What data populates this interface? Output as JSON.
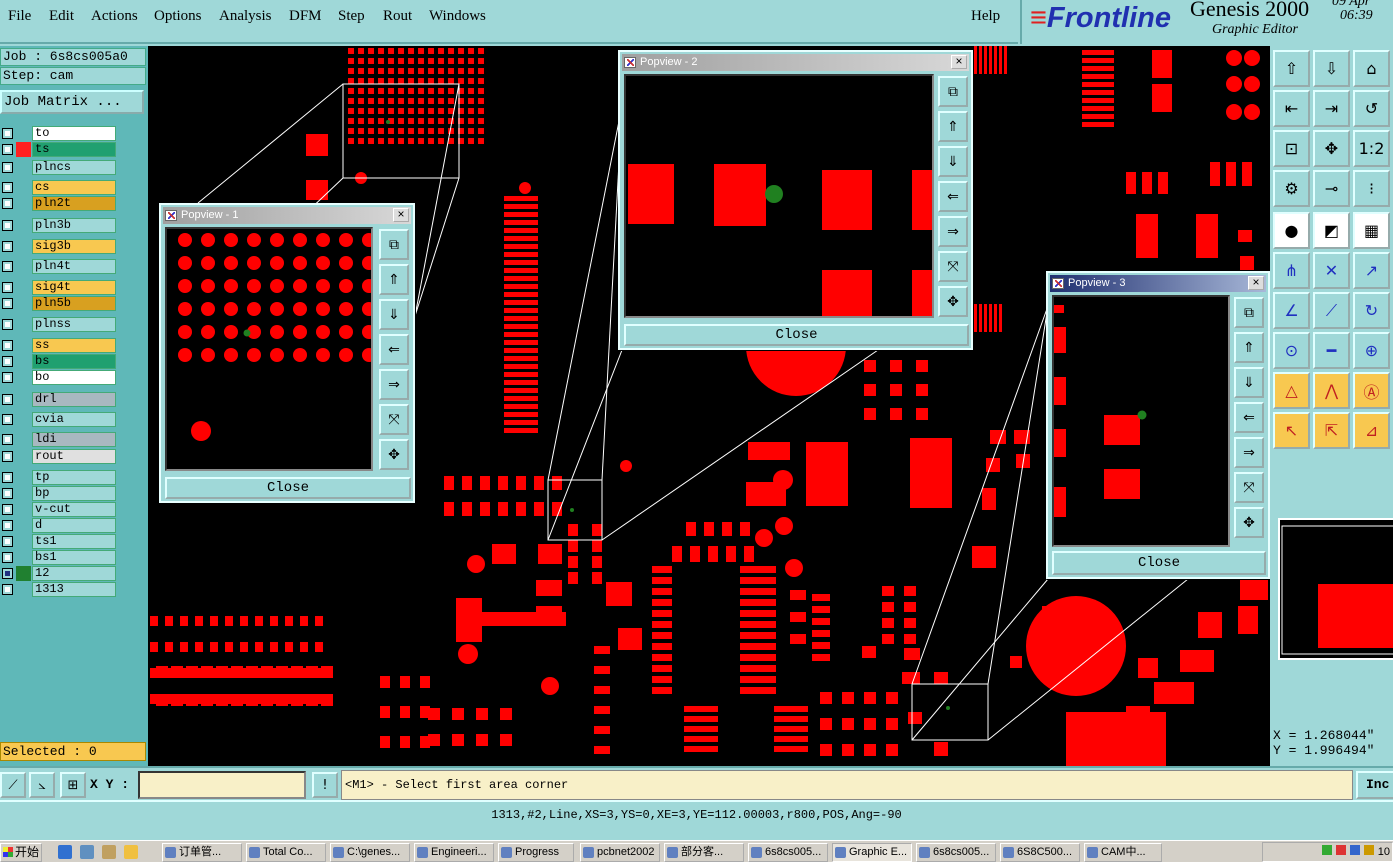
{
  "menu": [
    "File",
    "Edit",
    "Actions",
    "Options",
    "Analysis",
    "DFM",
    "Step",
    "Rout",
    "Windows"
  ],
  "help_label": "Help",
  "brand": {
    "logo": "Frontline",
    "product": "Genesis 2000",
    "subtitle": "Graphic Editor",
    "date": "09 Apr",
    "time": "06:39"
  },
  "job": {
    "job_line": "Job : 6s8cs005a0",
    "step_line": "Step: cam",
    "matrix_button": "Job Matrix ..."
  },
  "layers": [
    {
      "name": "to",
      "bg": "#ffffff",
      "mark": ""
    },
    {
      "name": "ts",
      "bg": "#20a070",
      "mark": "#ff2020"
    },
    {
      "name": "plncs",
      "bg": "#9fd8d8",
      "mark": ""
    },
    {
      "name": "cs",
      "bg": "#f8c850",
      "mark": ""
    },
    {
      "name": "pln2t",
      "bg": "#d8a020",
      "mark": ""
    },
    {
      "name": "pln3b",
      "bg": "#9fd8d8",
      "mark": ""
    },
    {
      "name": "sig3b",
      "bg": "#f8c850",
      "mark": ""
    },
    {
      "name": "pln4t",
      "bg": "#9fd8d8",
      "mark": ""
    },
    {
      "name": "sig4t",
      "bg": "#f8c850",
      "mark": ""
    },
    {
      "name": "pln5b",
      "bg": "#d8a020",
      "mark": ""
    },
    {
      "name": "plnss",
      "bg": "#9fd8d8",
      "mark": ""
    },
    {
      "name": "ss",
      "bg": "#f8c850",
      "mark": ""
    },
    {
      "name": "bs",
      "bg": "#20a070",
      "mark": ""
    },
    {
      "name": "bo",
      "bg": "#ffffff",
      "mark": ""
    },
    {
      "name": "drl",
      "bg": "#a8b8c0",
      "mark": ""
    },
    {
      "name": "cvia",
      "bg": "#9fd8d8",
      "mark": ""
    },
    {
      "name": "ldi",
      "bg": "#a8b8c0",
      "mark": ""
    },
    {
      "name": "rout",
      "bg": "#e0e0e0",
      "mark": ""
    },
    {
      "name": "tp",
      "bg": "#9fd8d8",
      "mark": ""
    },
    {
      "name": "bp",
      "bg": "#9fd8d8",
      "mark": ""
    },
    {
      "name": "v-cut",
      "bg": "#9fd8d8",
      "mark": ""
    },
    {
      "name": "d",
      "bg": "#9fd8d8",
      "mark": ""
    },
    {
      "name": "ts1",
      "bg": "#9fd8d8",
      "mark": ""
    },
    {
      "name": "bs1",
      "bg": "#9fd8d8",
      "mark": ""
    },
    {
      "name": "12",
      "bg": "#9fd8d8",
      "mark": "#208030"
    },
    {
      "name": "1313",
      "bg": "#9fd8d8",
      "mark": ""
    }
  ],
  "selected": "Selected : 0",
  "popups": [
    {
      "title": "Popview - 1",
      "close_label": "Close"
    },
    {
      "title": "Popview - 2",
      "close_label": "Close"
    },
    {
      "title": "Popview - 3",
      "close_label": "Close"
    }
  ],
  "zoom_scale_label": "1:2",
  "coords": {
    "x": "X = 1.268044\"",
    "y": "Y = 1.996494\""
  },
  "command": {
    "xy_label": "X Y :",
    "xy_value": "",
    "warn_icon": "!",
    "prompt": "<M1> - Select first area corner",
    "inc_label": "Inc"
  },
  "status": "1313,#2,Line,XS=3,YS=0,XE=3,YE=112.00003,r800,POS,Ang=-90",
  "taskbar": {
    "start": "开始",
    "tasks": [
      "订单管...",
      "Total Co...",
      "C:\\genes...",
      "Engineeri...",
      "Progress",
      "pcbnet2002",
      "部分客...",
      "6s8cs005...",
      "Graphic E...",
      "6s8cs005...",
      "6S8C500...",
      "CAM中..."
    ],
    "clock": "10"
  },
  "colors": {
    "pad": "#ff0000",
    "highlight": "#208020",
    "canvas": "#000000",
    "panel": "#9fd8d8"
  }
}
